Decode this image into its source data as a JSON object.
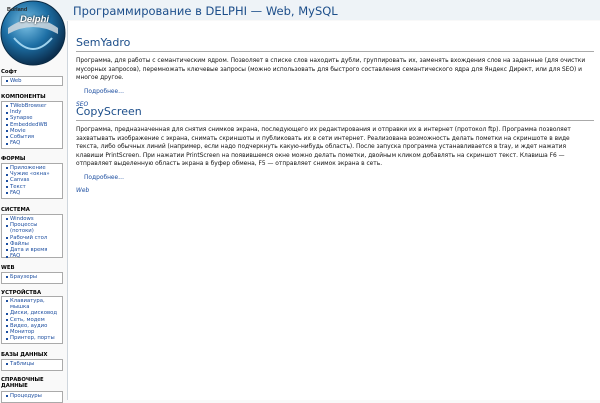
{
  "logo": {
    "brand": "Borland",
    "name": "Delphi"
  },
  "header": {
    "title": "Программирование в DELPHI — Web, MySQL"
  },
  "sidebar": {
    "sections": [
      {
        "title": "Софт",
        "items": [
          "Web"
        ]
      },
      {
        "title": "КОМПОНЕНТЫ",
        "items": [
          "TWebBrowser",
          "Indy",
          "Synapse",
          "EmbeddedWB",
          "Movie",
          "События",
          "FAQ"
        ]
      },
      {
        "title": "ФОРМЫ",
        "items": [
          "Приложение",
          "Чужие «окна»",
          "Canvas",
          "Текст",
          "FAQ"
        ]
      },
      {
        "title": "СИСТЕМА",
        "items": [
          "Windows",
          "Процессы (потоки)",
          "Рабочий стол",
          "Файлы",
          "Дата и время",
          "FAQ"
        ]
      },
      {
        "title": "WEB",
        "items": [
          "Браузеры"
        ]
      },
      {
        "title": "УСТРОЙСТВА",
        "items": [
          "Клавиатура, мышка",
          "Диски, дисковод",
          "Сеть, модем",
          "Видео, аудио",
          "Монитор",
          "Принтер, порты"
        ]
      },
      {
        "title": "БАЗЫ ДАННЫХ",
        "items": [
          "Таблицы"
        ]
      },
      {
        "title": "СПРАВОЧНЫЕ ДАННЫЕ",
        "items": [
          "Процедуры"
        ]
      }
    ]
  },
  "posts": [
    {
      "title": "SemYadro",
      "description": "Программа, для работы с семантическим ядром. Позволяет в списке слов находить дубли, группировать их, заменять вхождения слов на заданные (для очистки мусорных запросов), перемножать ключевые запросы (можно использовать для быстрого составления семантического ядра для Яндекс Директ, или для SEO) и многое другое.",
      "more": "Подробнее…",
      "tag": "SEO"
    },
    {
      "title": "CopyScreen",
      "description": "Программа, предназначенная для снятия снимков экрана, последующего их редактирования и отправки их в интернет (протокол ftp). Программа позволяет захватывать изображение с экрана, снимать скриншоты и публиковать их в сети интернет. Реализована возможность делать пометки на скриншоте в виде текста, либо обычных линий (например, если надо подчеркнуть какую-нибудь область). После запуска программа устанавливается в tray, и ждет нажатия клавиши PrintScreen. При нажатии PrintScreen на появившемся окне можно делать пометки, двойным кликом добавлять на скриншот текст. Клавиша F6 — отправляет выделенную область экрана в буфер обмена, F5 — отправляет снимок экрана в сеть.",
      "more": "Подробнее…",
      "tag": "Web"
    }
  ]
}
